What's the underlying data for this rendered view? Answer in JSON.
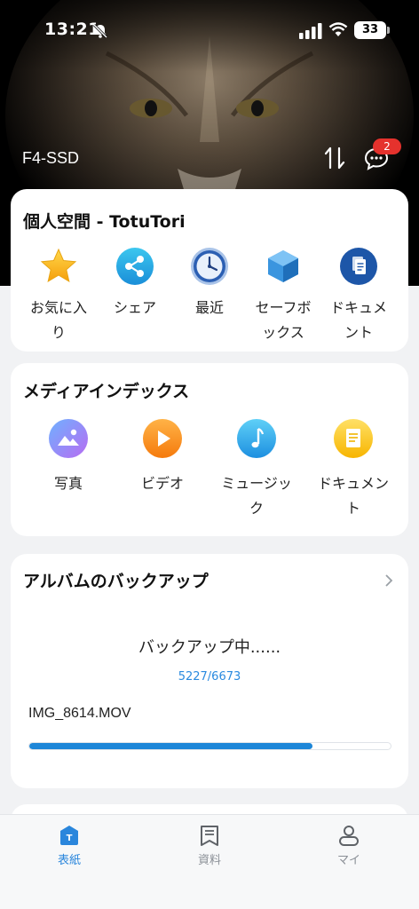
{
  "status_bar": {
    "time": "13:21",
    "battery": "33"
  },
  "hero": {
    "device_name": "F4-SSD",
    "message_badge": "2"
  },
  "personal": {
    "title": "個人空間 - TotuTori",
    "items": [
      {
        "label_lines": [
          "お気に入",
          "り"
        ],
        "icon": "star-icon"
      },
      {
        "label_lines": [
          "シェア",
          ""
        ],
        "icon": "share-icon"
      },
      {
        "label_lines": [
          "最近",
          ""
        ],
        "icon": "clock-icon"
      },
      {
        "label_lines": [
          "セーフボ",
          "ックス"
        ],
        "icon": "safebox-icon"
      },
      {
        "label_lines": [
          "ドキュメ",
          "ント"
        ],
        "icon": "document-icon"
      }
    ]
  },
  "media": {
    "title": "メディアインデックス",
    "items": [
      {
        "label_lines": [
          "写真",
          ""
        ],
        "icon": "photo-icon"
      },
      {
        "label_lines": [
          "ビデオ",
          ""
        ],
        "icon": "video-icon"
      },
      {
        "label_lines": [
          "ミュージッ",
          "ク"
        ],
        "icon": "music-icon"
      },
      {
        "label_lines": [
          "ドキュメン",
          "ト"
        ],
        "icon": "doc-file-icon"
      }
    ]
  },
  "backup": {
    "title": "アルバムのバックアップ",
    "status": "バックアップ中......",
    "count": "5227/6673",
    "file": "IMG_8614.MOV",
    "progress": 0.783
  },
  "tabbar": {
    "tabs": [
      {
        "label": "表紙",
        "active": true
      },
      {
        "label": "資料",
        "active": false
      },
      {
        "label": "マイ",
        "active": false
      }
    ]
  },
  "colors": {
    "accent": "#2a86dc",
    "badge": "#e5322d",
    "progress": "#1d86d8"
  }
}
